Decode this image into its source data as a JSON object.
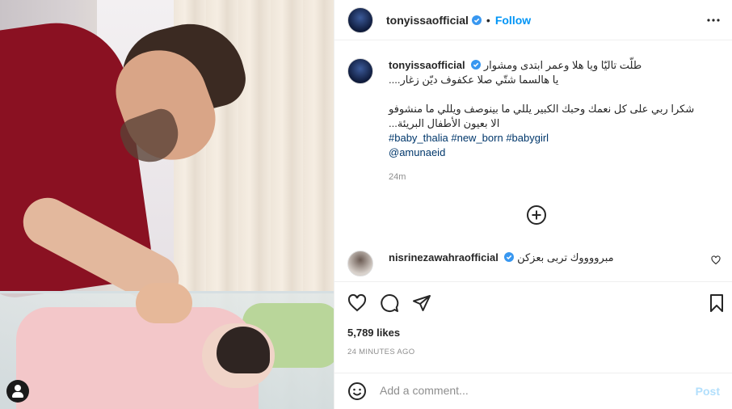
{
  "post": {
    "username": "tonyissaofficial",
    "follow_label": "Follow",
    "dot": "•"
  },
  "caption": {
    "username": "tonyissaofficial",
    "line1": "طلّت تاليّا ويا هلا وعمر ابتدى ومشوار",
    "line2": "يا هالسما شتّي صلا عكفوف ديّن زغار....",
    "line3": "شكرا ربي على كل نعمك وحبك الكبير يللي ما بينوصف ويللي ما منشوفو",
    "line4": "الا بعيون الأطفال البريئة...",
    "hashtags": [
      "#baby_thalia",
      "#new_born",
      "#babygirl"
    ],
    "mention": "@amunaeid",
    "time": "24m"
  },
  "comment": {
    "username": "nisrinezawahraofficial",
    "text": "مبرووووك تربى بعزكن"
  },
  "likes": "5,789 likes",
  "posted_ago": "24 MINUTES AGO",
  "add_comment": {
    "placeholder": "Add a comment...",
    "post_label": "Post"
  },
  "icons": {
    "more": "more-horizontal-icon",
    "verified": "verified-badge-icon",
    "load_more": "plus-circle-icon",
    "like": "heart-icon",
    "comment": "comment-bubble-icon",
    "share": "paper-plane-icon",
    "save": "bookmark-icon",
    "emoji": "emoji-smile-icon",
    "user_tag": "tagged-user-icon"
  },
  "colors": {
    "accent": "#0095f6",
    "verified": "#3897f0",
    "hashtag": "#00376b",
    "post_disabled": "#b2dffc"
  }
}
